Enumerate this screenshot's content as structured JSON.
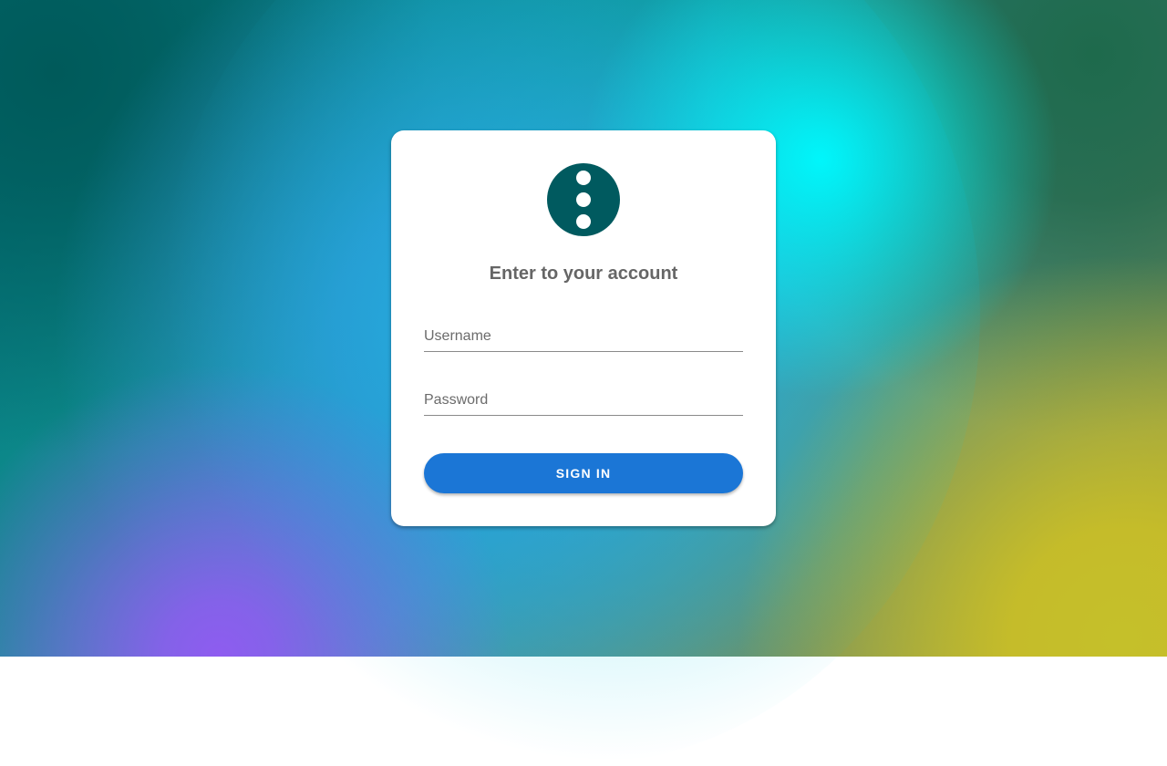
{
  "login": {
    "title": "Enter to your account",
    "username_placeholder": "Username",
    "password_placeholder": "Password",
    "signin_label": "SIGN IN",
    "logo_icon": "three-dots-vertical-icon"
  },
  "colors": {
    "logo_background": "#005a5f",
    "button_background": "#1b76d6",
    "title_text": "#666666"
  }
}
